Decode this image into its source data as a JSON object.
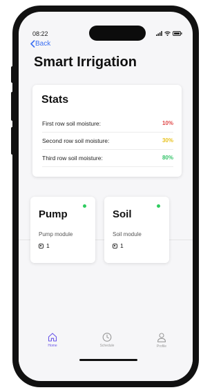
{
  "status_bar": {
    "time": "08:22"
  },
  "nav": {
    "back_label": "Back"
  },
  "page": {
    "title": "Smart Irrigation"
  },
  "stats": {
    "heading": "Stats",
    "rows": [
      {
        "label": "First row soil moisture:",
        "value": "10%",
        "color": "#e04848"
      },
      {
        "label": "Second row soil moisture:",
        "value": "30%",
        "color": "#e8c21e"
      },
      {
        "label": "Third row soil moisture:",
        "value": "80%",
        "color": "#35c46a"
      }
    ]
  },
  "cards": [
    {
      "title": "Pump",
      "subtitle": "Pump module",
      "count": "1",
      "status_color": "#2ecc5f",
      "icon": "chip-icon"
    },
    {
      "title": "Soil",
      "subtitle": "Soil module",
      "count": "1",
      "status_color": "#2ecc5f",
      "icon": "chip-icon"
    }
  ],
  "tabs": [
    {
      "label": "Home",
      "icon": "home-icon",
      "active": true,
      "color": "#6a56e8"
    },
    {
      "label": "Schedule",
      "icon": "clock-icon",
      "active": false,
      "color": "#9a9a9a"
    },
    {
      "label": "Profile",
      "icon": "user-icon",
      "active": false,
      "color": "#9a9a9a"
    }
  ]
}
